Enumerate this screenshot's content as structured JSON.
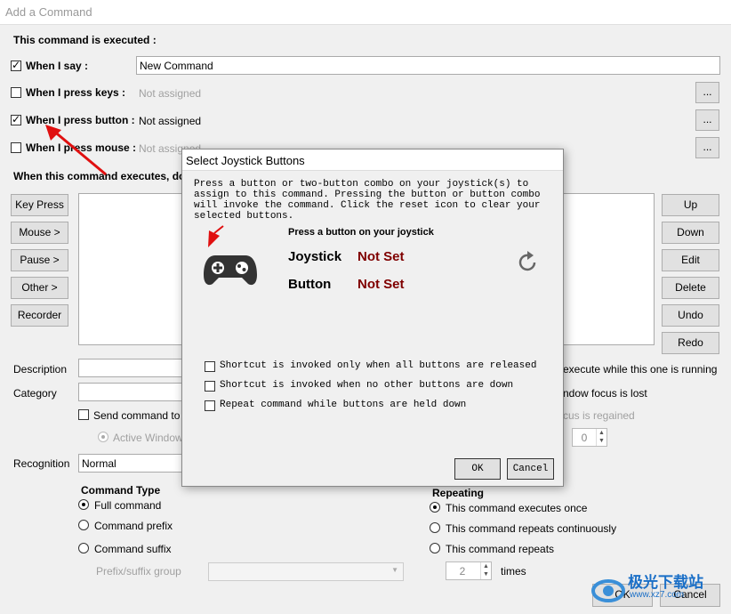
{
  "window": {
    "title": "Add a Command"
  },
  "executed_header": "This command is executed :",
  "triggers": {
    "say": {
      "label": "When I say :",
      "value": "New Command",
      "checked": true
    },
    "keys": {
      "label": "When I press keys :",
      "value": "Not assigned",
      "checked": false
    },
    "button": {
      "label": "When I press button :",
      "value": "Not assigned",
      "checked": true
    },
    "mouse": {
      "label": "When I press mouse :",
      "value": "Not assigned",
      "checked": false
    },
    "browse_label": "..."
  },
  "executes_header": "When this command executes, do th",
  "left_buttons": [
    "Key Press",
    "Mouse >",
    "Pause >",
    "Other >",
    "Recorder"
  ],
  "right_buttons": [
    "Up",
    "Down",
    "Edit",
    "Delete",
    "Undo",
    "Redo"
  ],
  "fields": {
    "description_label": "Description",
    "category_label": "Category",
    "send_command_label": "Send command to t",
    "active_window_label": "Active Window",
    "execute_while_label": "execute while this one is running",
    "window_focus_lost_label": "ndow focus is lost",
    "focus_regained_label": "cus is regained",
    "spin_value": "0",
    "recognition_label": "Recognition",
    "recognition_value": "Normal"
  },
  "command_type": {
    "header": "Command Type",
    "options": [
      "Full command",
      "Command prefix",
      "Command suffix"
    ],
    "selected": 0,
    "prefix_group_label": "Prefix/suffix group"
  },
  "repeating": {
    "header": "Repeating",
    "options": [
      "This command executes once",
      "This command repeats continuously",
      "This command repeats"
    ],
    "selected": 0,
    "times_value": "2",
    "times_label": "times"
  },
  "footer": {
    "ok_label": "OK",
    "cancel_label": "Cancel"
  },
  "dialog": {
    "title": "Select Joystick Buttons",
    "instructions": "Press a button or two-button combo on your joystick(s) to assign to this command.  Pressing the button or button combo will invoke the command.  Click the reset icon to clear your selected buttons.",
    "prompt": "Press a button on your joystick",
    "joystick_label": "Joystick",
    "joystick_value": "Not Set",
    "button_label": "Button",
    "button_value": "Not Set",
    "options": [
      "Shortcut is invoked only when all buttons are released",
      "Shortcut is invoked when no other buttons are down",
      "Repeat command while buttons are held down"
    ],
    "ok_label": "OK",
    "cancel_label": "Cancel"
  },
  "watermark": {
    "text": "极光下载站",
    "url": "www.xz7.com"
  },
  "icons": {
    "gamepad": "gamepad-icon",
    "reset": "reset-icon",
    "arrow": "red-arrow-annotation"
  },
  "colors": {
    "not_set": "#7f0000",
    "arrow": "#e01010"
  }
}
